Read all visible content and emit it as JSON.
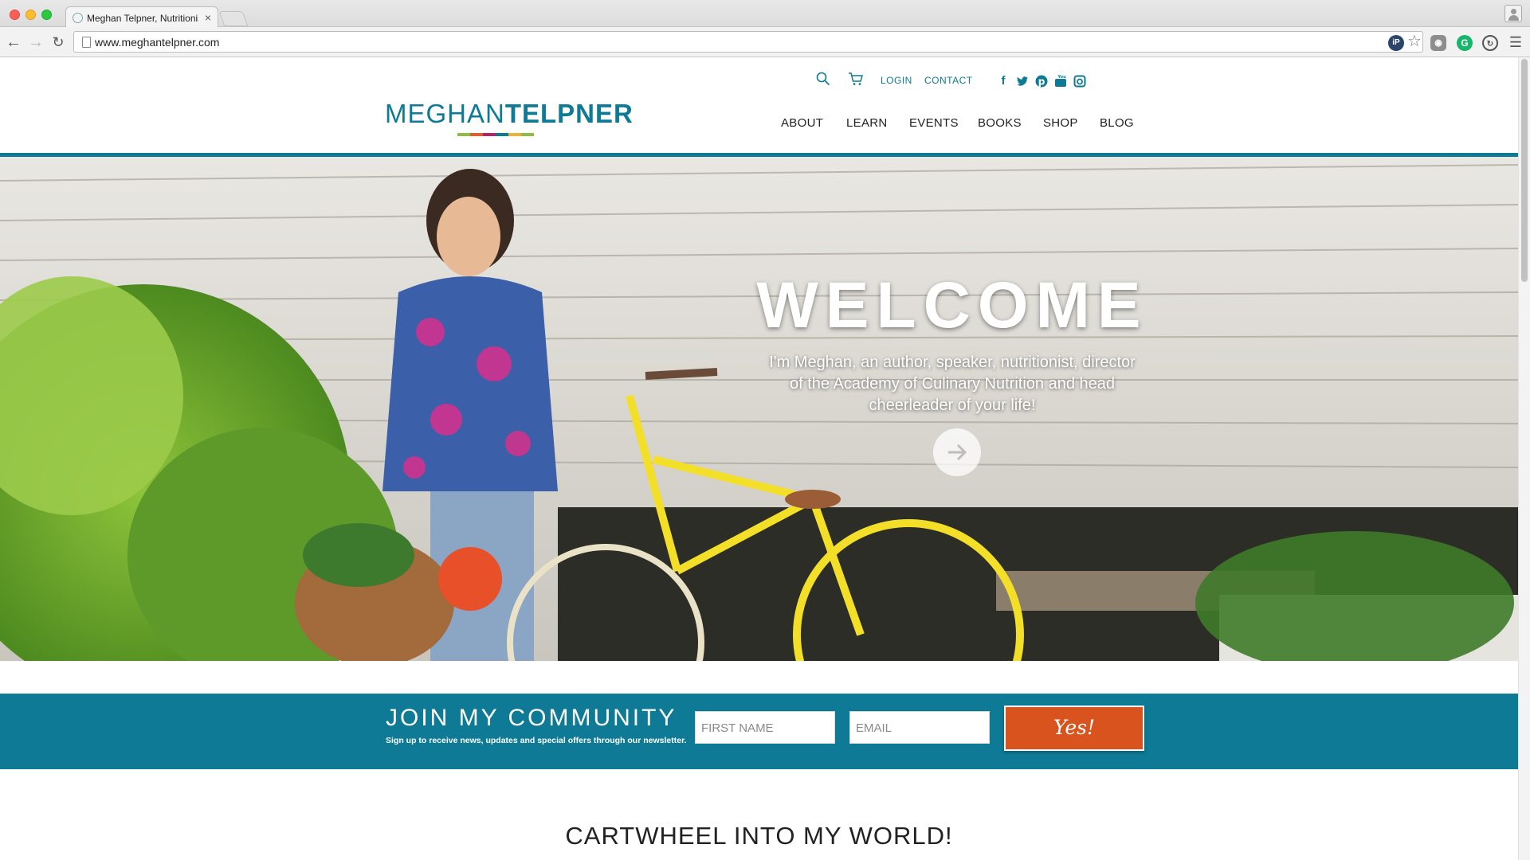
{
  "browser": {
    "tab_title": "Meghan Telpner, Nutritionist",
    "tab_close": "×",
    "url": "www.meghantelpner.com"
  },
  "header": {
    "logo_first": "MEGHAN",
    "logo_last": "TELPNER",
    "logo_bar_colors": [
      "#8cbf3f",
      "#e85a2b",
      "#b3256b",
      "#0e7a95",
      "#f2b231",
      "#8cbf3f"
    ],
    "login": "LOGIN",
    "contact": "CONTACT",
    "social_icons": [
      "facebook-icon",
      "twitter-icon",
      "pinterest-icon",
      "youtube-icon",
      "instagram-icon"
    ],
    "nav": {
      "about": "ABOUT",
      "learn": "LEARN",
      "events": "EVENTS",
      "books": "BOOKS",
      "shop": "SHOP",
      "blog": "BLOG"
    }
  },
  "hero": {
    "title": "WELCOME",
    "subtitle": "I'm Meghan, an author, speaker, nutritionist, director of the Academy of Culinary Nutrition and head cheerleader of your life!"
  },
  "community": {
    "title": "JOIN MY COMMUNITY",
    "subtitle": "Sign up to receive news, updates and special offers through our newsletter.",
    "first_name_placeholder": "FIRST NAME",
    "email_placeholder": "EMAIL",
    "button": "Yes!"
  },
  "section": {
    "heading": "CARTWHEEL INTO MY WORLD!"
  },
  "colors": {
    "brand_teal": "#0e7a95",
    "cta_orange": "#d9531e"
  }
}
